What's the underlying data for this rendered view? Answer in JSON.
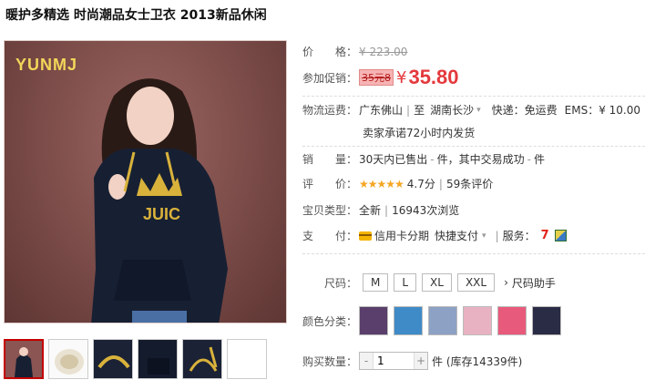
{
  "title": "暖护多精选 时尚潮品女士卫衣 2013新品休闲",
  "image": {
    "brand": "YUNMJ"
  },
  "info": {
    "price_label": "价　　格：",
    "original_price": "¥ 223.00",
    "promo_label": "参加促销：",
    "promo_tag": "35元8",
    "promo_currency": "¥",
    "promo_price": "35.80",
    "shipping_label": "物流运费：",
    "ship_from": "广东佛山",
    "ship_to_prefix": "至",
    "ship_to": "湖南长沙",
    "express": "快递：免运费",
    "ems": "EMS：¥ 10.00",
    "ship_note": "卖家承诺72小时内发货",
    "sales_label": "销　　量：",
    "sales_text": "30天内已售出",
    "sales_count": "-",
    "sales_unit": "件，其中交易成功",
    "sales_success": "-",
    "sales_tail": "件",
    "rating_label": "评　　价：",
    "stars": "★★★★★",
    "rating_score": "4.7分",
    "review_count": "59条评价",
    "type_label": "宝贝类型：",
    "type_value": "全新",
    "views": "16943次浏览",
    "pay_label": "支　　付：",
    "pay_credit": "信用卡分期",
    "pay_fast": "快捷支付",
    "service_label": "服务：",
    "size_label": "尺码：",
    "sizes": [
      "M",
      "L",
      "XL",
      "XXL"
    ],
    "size_helper": "尺码助手",
    "color_label": "颜色分类：",
    "qty_label": "购买数量：",
    "qty_value": "1",
    "stock": "件 (库存14339件)"
  },
  "colors": {
    "swatches": [
      "#5a3e6b",
      "#3f8bc7",
      "#8da1c4",
      "#e8b2c2",
      "#e85a7b",
      "#2a2b45"
    ]
  }
}
